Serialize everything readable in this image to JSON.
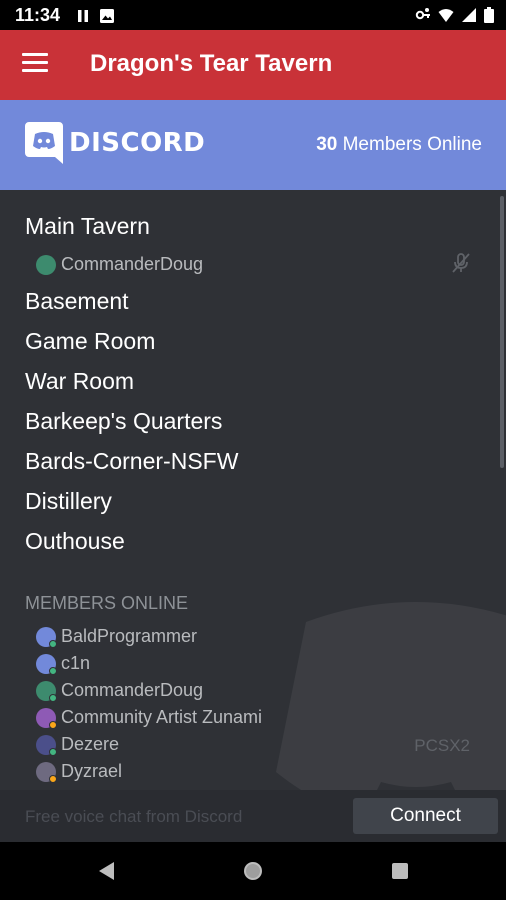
{
  "status_bar": {
    "time": "11:34",
    "left_icons": [
      "pause-icon",
      "image-icon"
    ],
    "right_icons": [
      "vpn-key-icon",
      "wifi-icon",
      "signal-icon",
      "battery-icon"
    ]
  },
  "app_bar": {
    "menu_icon": "hamburger-menu-icon",
    "title": "Dragon's Tear Tavern",
    "color": "#c93238"
  },
  "discord_header": {
    "brand": "DISCORD",
    "members_online_count": "30",
    "members_online_label": "Members Online",
    "color": "#7289da"
  },
  "channels": [
    {
      "name": "Main Tavern",
      "members": [
        {
          "name": "CommanderDoug",
          "muted": true
        }
      ]
    },
    {
      "name": "Basement"
    },
    {
      "name": "Game Room"
    },
    {
      "name": "War Room"
    },
    {
      "name": "Barkeep's Quarters"
    },
    {
      "name": "Bards-Corner-NSFW"
    },
    {
      "name": "Distillery"
    },
    {
      "name": "Outhouse"
    }
  ],
  "members_section": {
    "label": "MEMBERS ONLINE",
    "members": [
      {
        "name": "BaldProgrammer",
        "avatar_color": "#7289da",
        "status_color": "#43b581"
      },
      {
        "name": "c1n",
        "avatar_color": "#7289da",
        "status_color": "#43b581"
      },
      {
        "name": "CommanderDoug",
        "avatar_color": "#3d8b6e",
        "status_color": "#43b581"
      },
      {
        "name": "Community Artist Zunami",
        "avatar_color": "#8e5ab5",
        "status_color": "#faa61a"
      },
      {
        "name": "Dezere",
        "avatar_color": "#4b4f8a",
        "status_color": "#43b581",
        "game": "PCSX2"
      },
      {
        "name": "Dyzrael",
        "avatar_color": "#6e6a80",
        "status_color": "#faa61a"
      }
    ]
  },
  "footer": {
    "text": "Free voice chat from Discord",
    "connect_label": "Connect"
  },
  "nav_bar": {
    "back": "back-triangle-icon",
    "home": "home-circle-icon",
    "recents": "recents-square-icon"
  }
}
